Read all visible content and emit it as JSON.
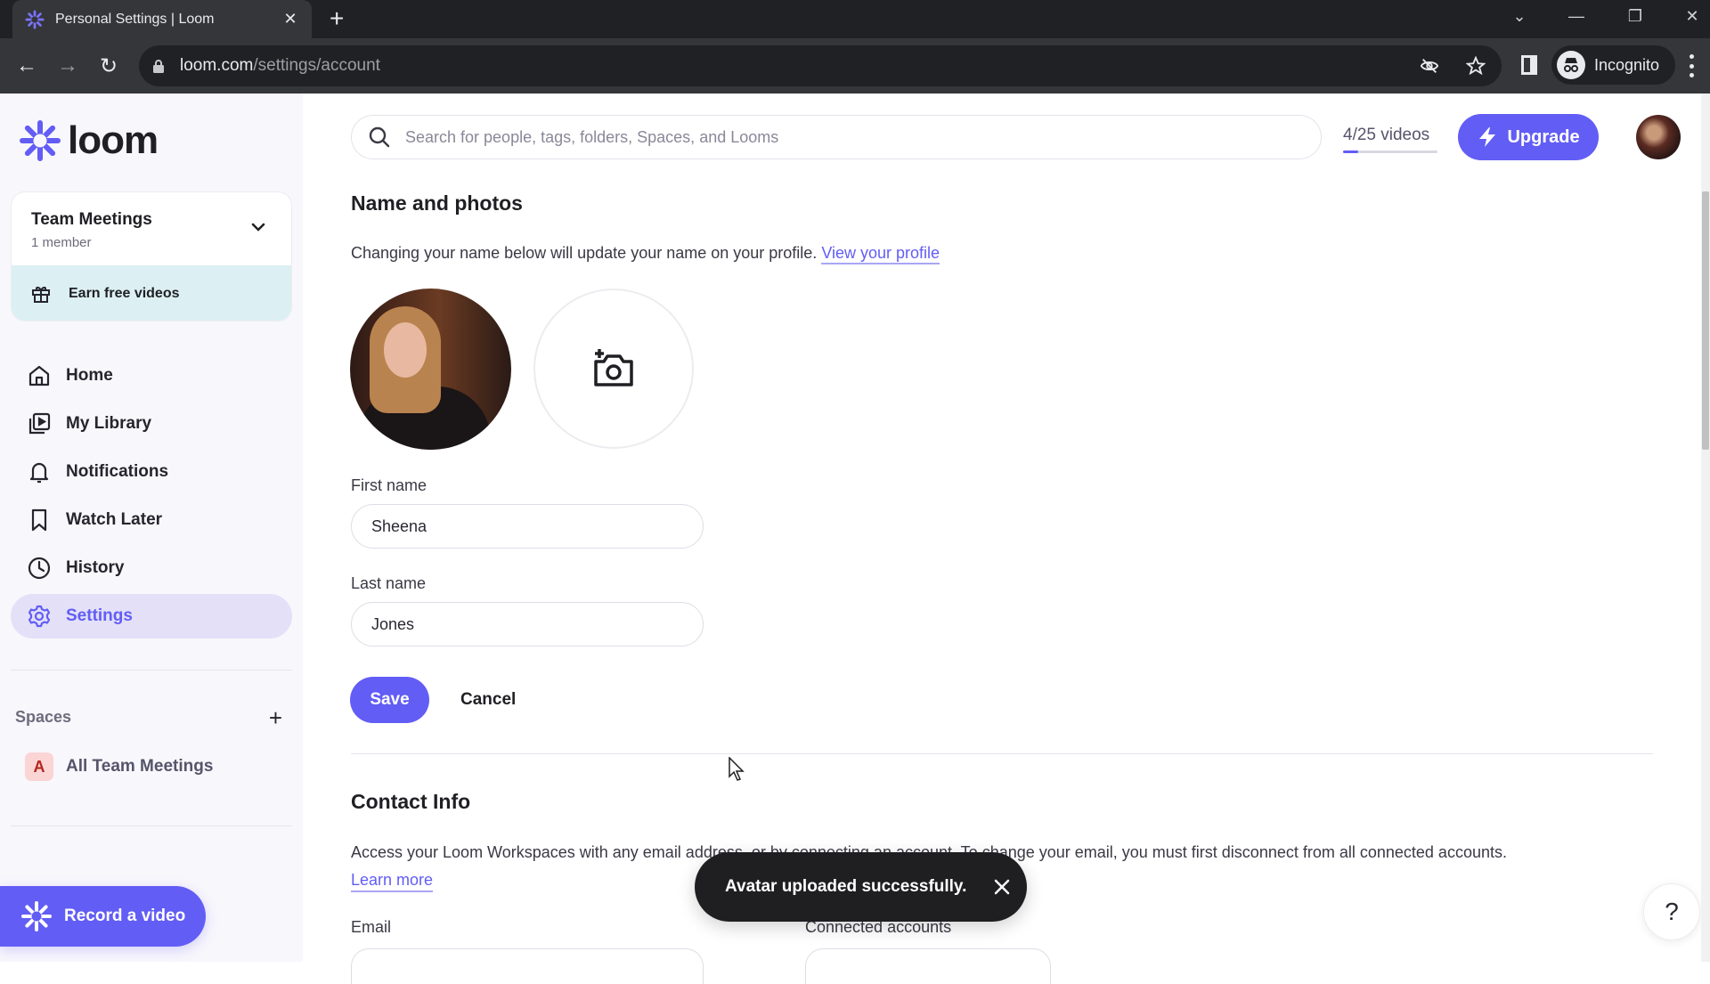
{
  "browser": {
    "tab_title": "Personal Settings | Loom",
    "url_host": "loom.com",
    "url_path": "/settings/account",
    "profile_label": "Incognito"
  },
  "sidebar": {
    "logo_text": "loom",
    "workspace": {
      "name": "Team Meetings",
      "members": "1 member"
    },
    "earn_label": "Earn free videos",
    "nav": [
      {
        "label": "Home",
        "icon": "home-icon"
      },
      {
        "label": "My Library",
        "icon": "library-icon"
      },
      {
        "label": "Notifications",
        "icon": "bell-icon"
      },
      {
        "label": "Watch Later",
        "icon": "bookmark-icon"
      },
      {
        "label": "History",
        "icon": "clock-icon"
      },
      {
        "label": "Settings",
        "icon": "gear-icon",
        "active": true
      }
    ],
    "spaces_title": "Spaces",
    "spaces": [
      {
        "badge": "A",
        "label": "All Team Meetings"
      }
    ],
    "record_label": "Record a video"
  },
  "header": {
    "search_placeholder": "Search for people, tags, folders, Spaces, and Looms",
    "quota_label": "4/25 videos",
    "quota_used": 4,
    "quota_total": 25,
    "upgrade_label": "Upgrade"
  },
  "name_section": {
    "title": "Name and photos",
    "description": "Changing your name below will update your name on your profile.",
    "profile_link": "View your profile",
    "first_name_label": "First name",
    "first_name_value": "Sheena",
    "last_name_label": "Last name",
    "last_name_value": "Jones",
    "save_label": "Save",
    "cancel_label": "Cancel"
  },
  "contact_section": {
    "title": "Contact Info",
    "description": "Access your Loom Workspaces with any email address, or by connecting an account. To change your email, you must first disconnect from all connected accounts.",
    "learn_more": "Learn more",
    "email_label": "Email",
    "connected_label": "Connected accounts"
  },
  "toast": {
    "message": "Avatar uploaded successfully."
  },
  "help": {
    "label": "?"
  },
  "colors": {
    "accent": "#625df5",
    "active_nav_bg": "#e3e0f8",
    "earn_bg": "#dcf0f3",
    "toast_bg": "#1f1f22"
  }
}
